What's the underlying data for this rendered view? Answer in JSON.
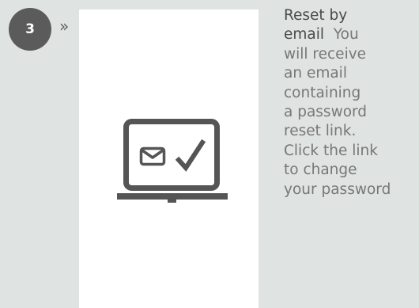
{
  "step": {
    "number": "3",
    "arrow": "»"
  },
  "illustration": {
    "icon": "laptop-email-check-icon",
    "color": "#555555"
  },
  "description": {
    "title_line1": "Reset by",
    "title_line2": "email",
    "body_line1": "You",
    "body_line2": "will receive",
    "body_line3": "an email",
    "body_line4": "containing",
    "body_line5": "a password",
    "body_line6": "reset link.",
    "body_line7": "Click the link",
    "body_line8": "to change",
    "body_line9": "your password"
  },
  "colors": {
    "background": "#dfe3e2",
    "panel": "#ffffff",
    "badge": "#5b5b5b",
    "heading_text": "#4a4a4a",
    "body_text": "#777777"
  }
}
